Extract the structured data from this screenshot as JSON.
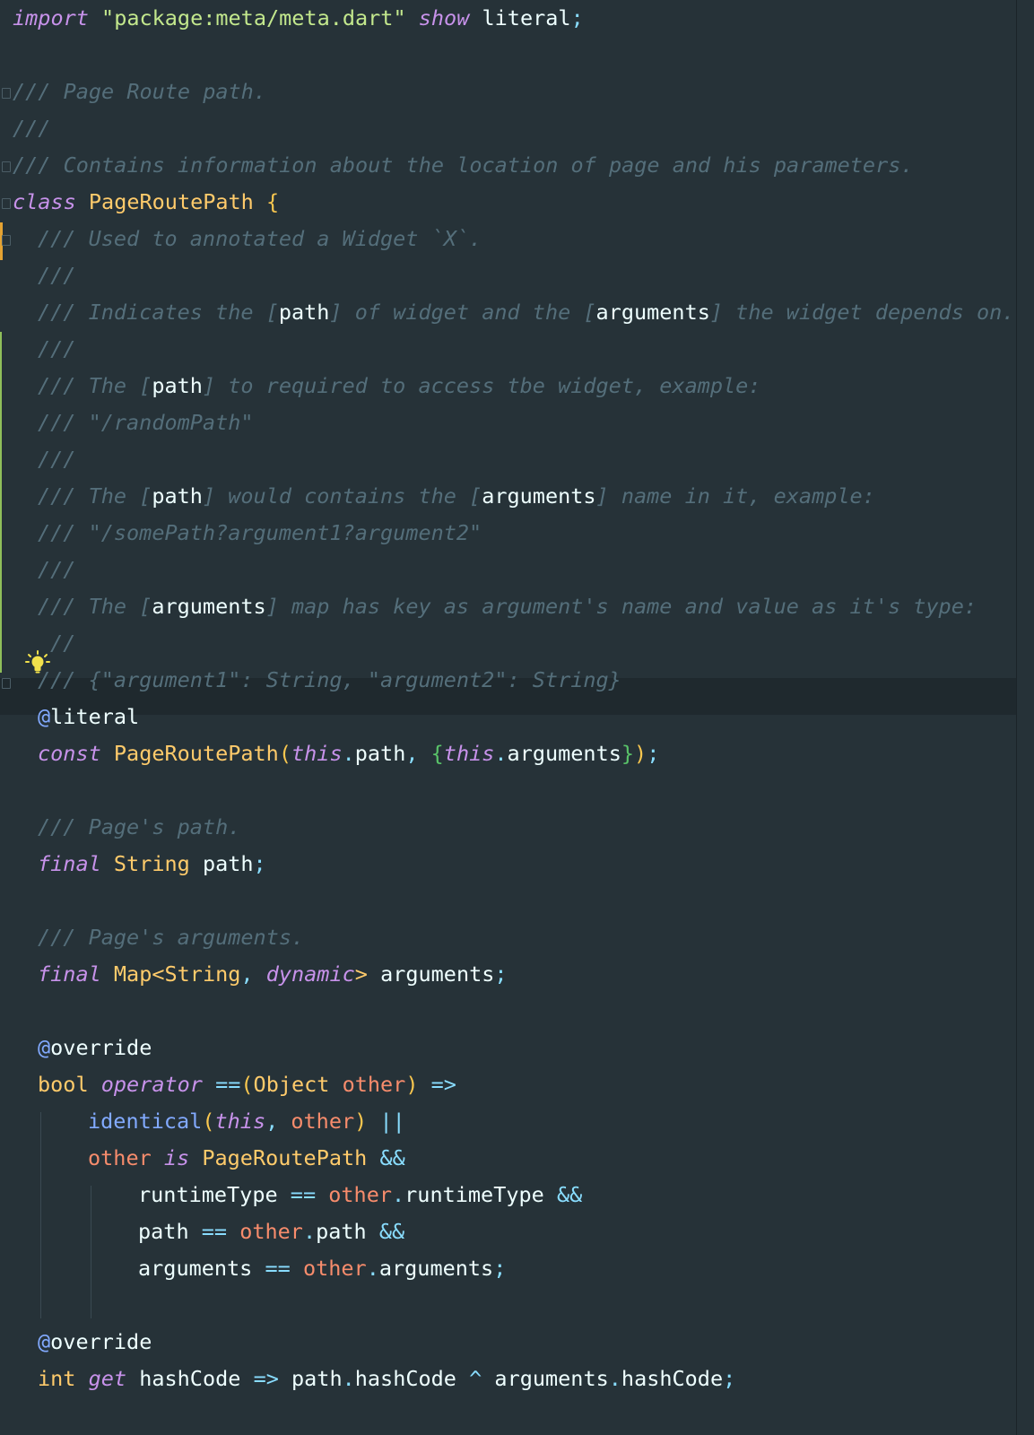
{
  "editor": {
    "language": "dart",
    "colors": {
      "background": "#263238",
      "keyword": "#C792EA",
      "string": "#C3E88D",
      "comment": "#546E7A",
      "type": "#FFCB6B",
      "punctuation": "#89DDFF",
      "parameter": "#F78C6C",
      "function": "#82AAFF"
    },
    "gutter_icons": [
      "fold-marker-icon",
      "lightbulb-icon"
    ],
    "code": {
      "l1": {
        "kw_import": "import",
        "str_pkg": "\"package:meta/meta.dart\"",
        "kw_show": "show",
        "id": "literal",
        "semi": ";"
      },
      "l3": {
        "cmt": "/// Page Route path."
      },
      "l4": {
        "cmt": "///"
      },
      "l5": {
        "cmt": "/// Contains information about the location of page and his parameters."
      },
      "l6": {
        "kw": "class",
        "type": "PageRoutePath",
        "brace": "{"
      },
      "l7": {
        "cmt": "/// Used to annotated a Widget `X`."
      },
      "l8": {
        "cmt": "///"
      },
      "l9": {
        "a": "/// Indicates the [",
        "r1": "path",
        "b": "] of widget and the [",
        "r2": "arguments",
        "c": "] the widget depends on."
      },
      "l10": {
        "cmt": "///"
      },
      "l11": {
        "a": "/// The [",
        "r1": "path",
        "b": "] to required to access tbe widget, example:"
      },
      "l12": {
        "cmt": "/// \"/randomPath\""
      },
      "l13": {
        "cmt": "///"
      },
      "l14": {
        "a": "/// The [",
        "r1": "path",
        "b": "] would contains the [",
        "r2": "arguments",
        "c": "] name in it, example:"
      },
      "l15": {
        "cmt": "/// \"/somePath?argument1?argument2\""
      },
      "l16": {
        "cmt": "///"
      },
      "l17": {
        "a": "/// The [",
        "r1": "arguments",
        "b": "] map has key as argument's name and value as it's type:"
      },
      "l18": {
        "cmt": "//"
      },
      "l19": {
        "cmt": "/// {\"argument1\": String, \"argument2\": String}"
      },
      "l20": {
        "at": "@",
        "ann": "literal"
      },
      "l21": {
        "kw": "const",
        "type": "PageRoutePath",
        "p1": "(",
        "this1": "this",
        "dot1": ".",
        "f1": "path",
        "comma": ", ",
        "b1": "{",
        "this2": "this",
        "dot2": ".",
        "f2": "arguments",
        "b2": "}",
        "p2": ")",
        "semi": ";"
      },
      "l23": {
        "cmt": "/// Page's path."
      },
      "l24": {
        "kw": "final",
        "type": "String",
        "id": "path",
        "semi": ";"
      },
      "l26": {
        "cmt": "/// Page's arguments."
      },
      "l27": {
        "kw": "final",
        "type": "Map",
        "lt": "<",
        "t2": "String",
        "comma": ", ",
        "dyn": "dynamic",
        "gt": ">",
        "id": "arguments",
        "semi": ";"
      },
      "l29": {
        "at": "@",
        "ann": "override"
      },
      "l30": {
        "type": "bool",
        "kw": "operator",
        "op": "==",
        "p1": "(",
        "t2": "Object",
        "param": "other",
        "p2": ")",
        "arrow": "=>"
      },
      "l31": {
        "fn": "identical",
        "p1": "(",
        "kw": "this",
        "comma": ", ",
        "param": "other",
        "p2": ")",
        "or": "||"
      },
      "l32": {
        "param": "other",
        "kw": "is",
        "type": "PageRoutePath",
        "and": "&&"
      },
      "l33": {
        "id": "runtimeType",
        "eq": "==",
        "param": "other",
        "dot": ".",
        "f": "runtimeType",
        "and": "&&"
      },
      "l34": {
        "id": "path",
        "eq": "==",
        "param": "other",
        "dot": ".",
        "f": "path",
        "and": "&&"
      },
      "l35": {
        "id": "arguments",
        "eq": "==",
        "param": "other",
        "dot": ".",
        "f": "arguments",
        "semi": ";"
      },
      "l37": {
        "at": "@",
        "ann": "override"
      },
      "l38": {
        "type": "int",
        "kw": "get",
        "id": "hashCode",
        "arrow": "=>",
        "a": "path",
        "dot1": ".",
        "b": "hashCode",
        "xor": "^",
        "c": "arguments",
        "dot2": ".",
        "d": "hashCode",
        "semi": ";"
      }
    }
  }
}
